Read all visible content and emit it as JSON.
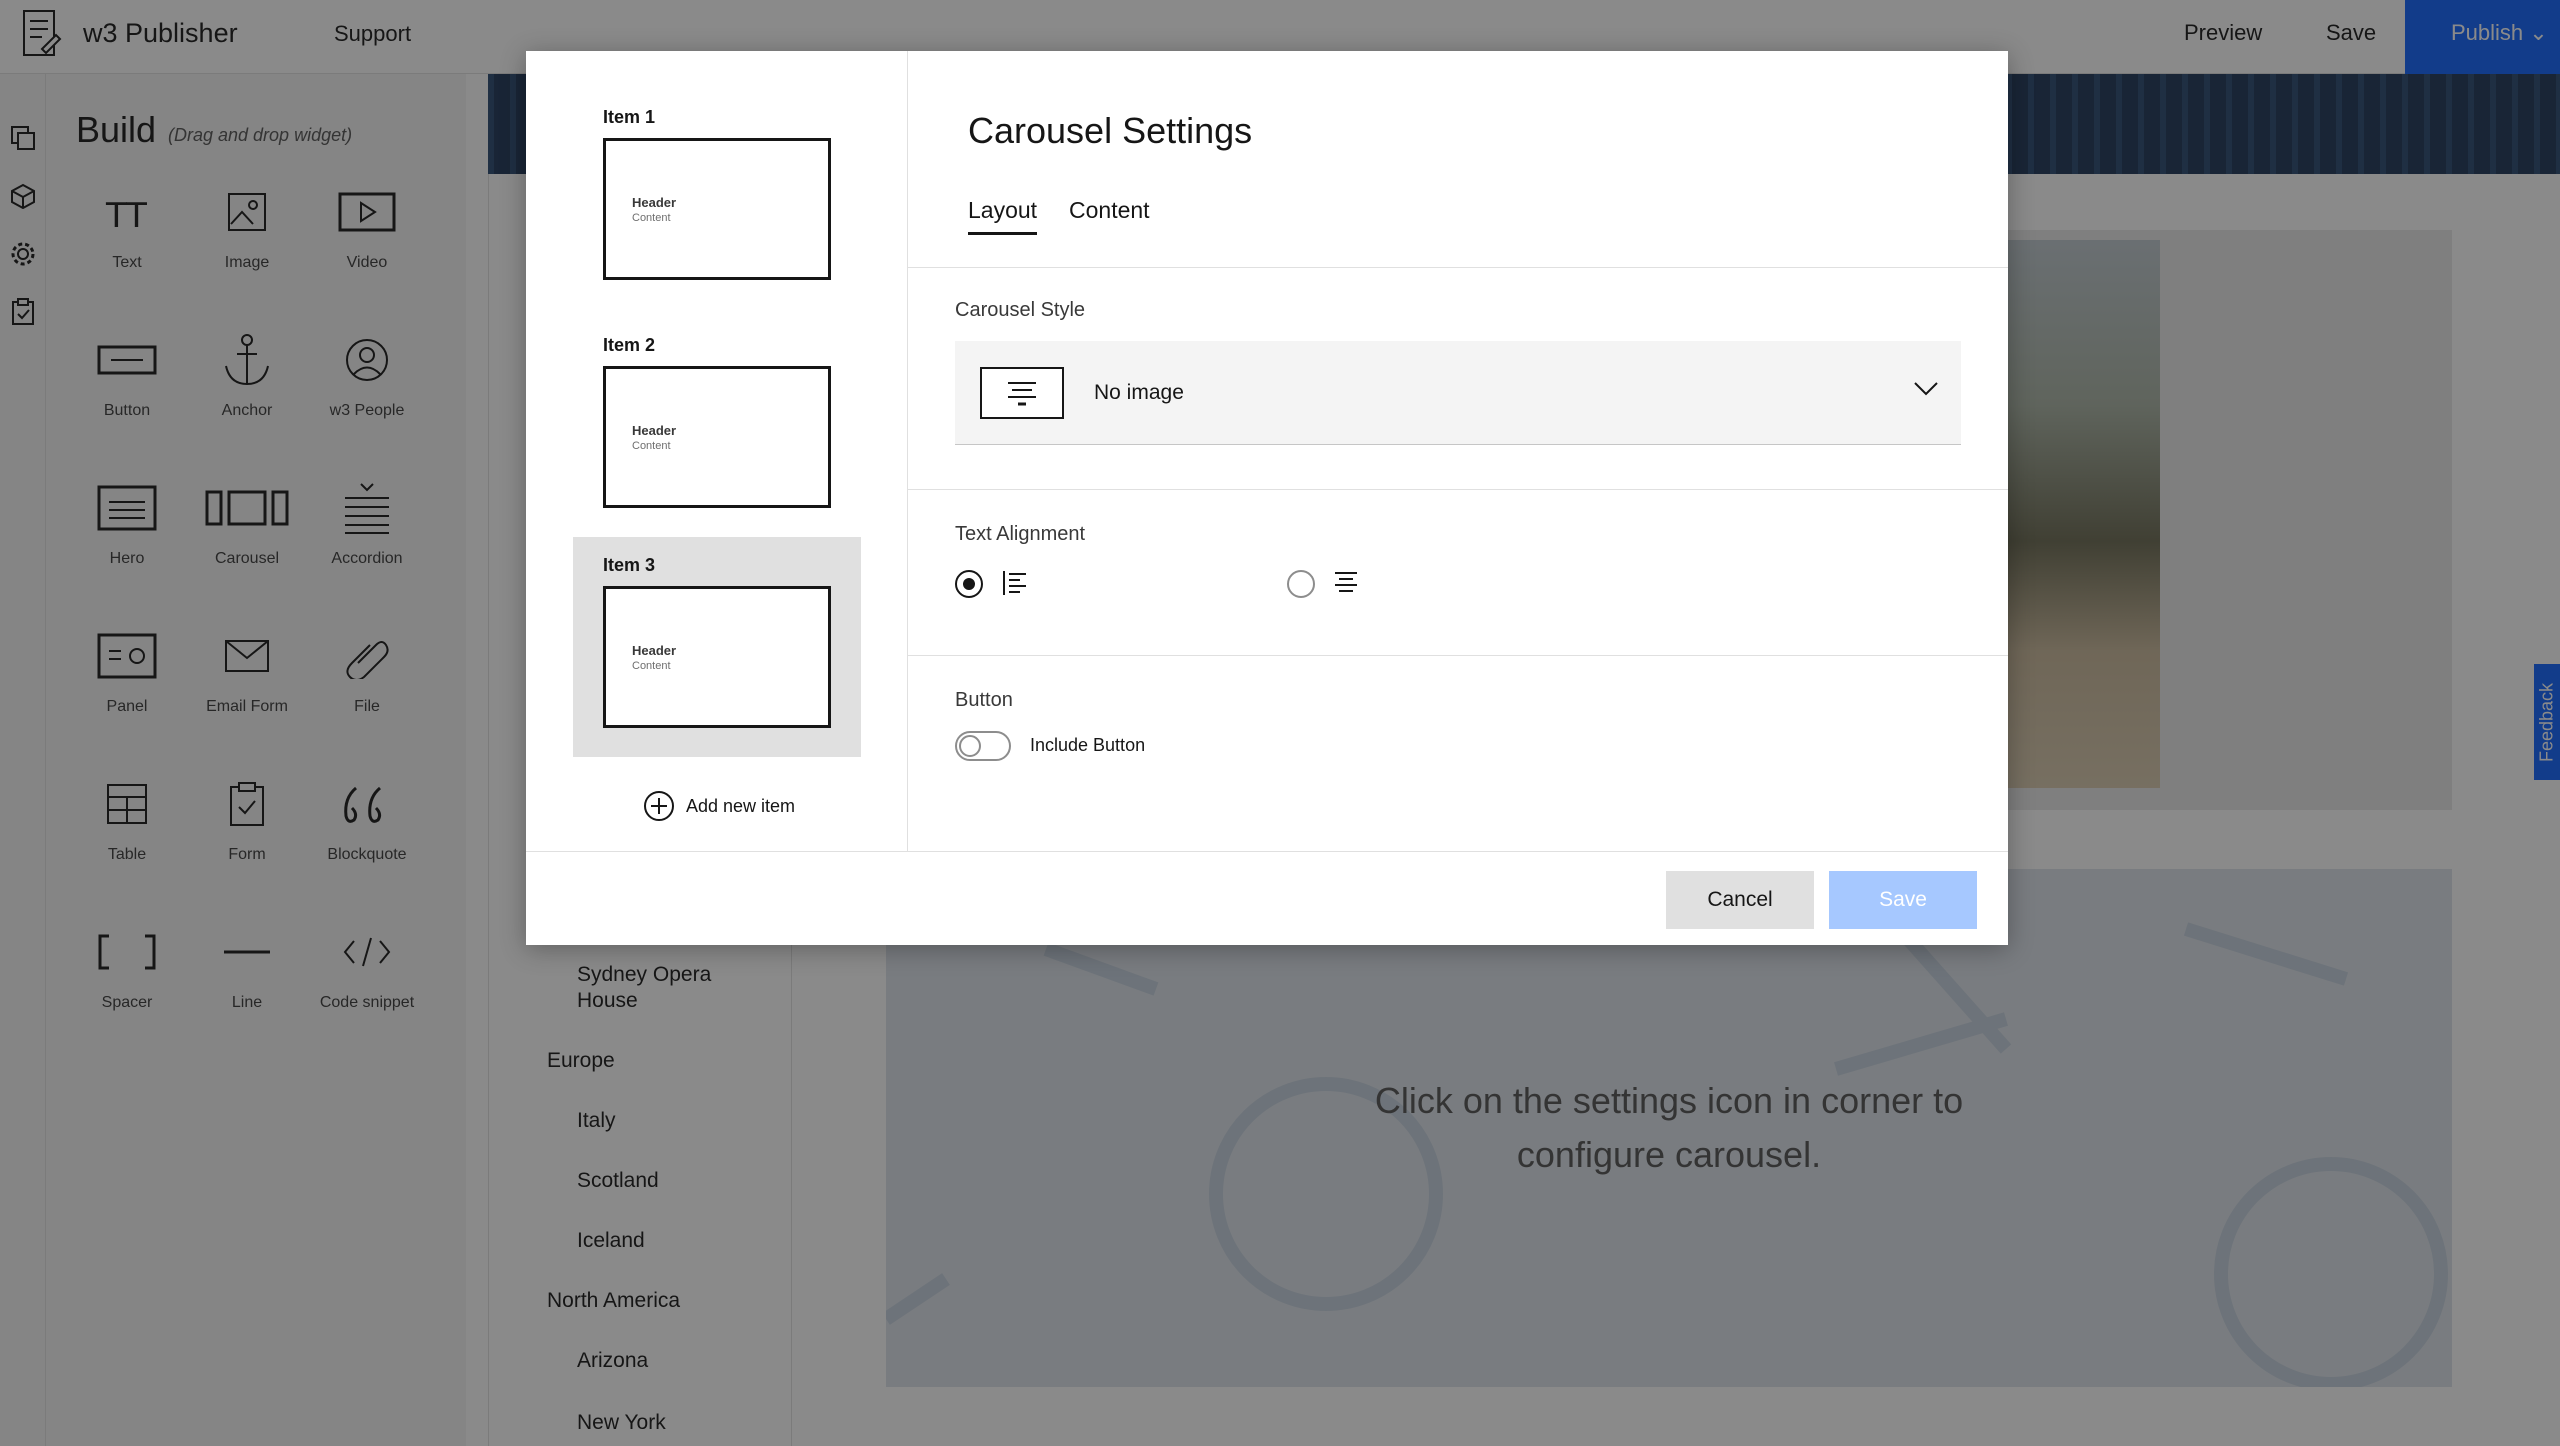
{
  "topbar": {
    "app_title": "w3 Publisher",
    "support": "Support",
    "preview": "Preview",
    "save": "Save",
    "publish": "Publish"
  },
  "build": {
    "title": "Build",
    "subtitle": "(Drag and drop widget)",
    "widgets": [
      {
        "label": "Text",
        "icon": "text-icon"
      },
      {
        "label": "Image",
        "icon": "image-icon"
      },
      {
        "label": "Video",
        "icon": "video-icon"
      },
      {
        "label": "Button",
        "icon": "button-icon"
      },
      {
        "label": "Anchor",
        "icon": "anchor-icon"
      },
      {
        "label": "w3 People",
        "icon": "people-icon"
      },
      {
        "label": "Hero",
        "icon": "hero-icon"
      },
      {
        "label": "Carousel",
        "icon": "carousel-icon"
      },
      {
        "label": "Accordion",
        "icon": "accordion-icon"
      },
      {
        "label": "Panel",
        "icon": "panel-icon"
      },
      {
        "label": "Email Form",
        "icon": "email-icon"
      },
      {
        "label": "File",
        "icon": "paperclip-icon"
      },
      {
        "label": "Table",
        "icon": "table-icon"
      },
      {
        "label": "Form",
        "icon": "clipboard-icon"
      },
      {
        "label": "Blockquote",
        "icon": "quote-icon"
      },
      {
        "label": "Spacer",
        "icon": "spacer-icon"
      },
      {
        "label": "Line",
        "icon": "line-icon"
      },
      {
        "label": "Code snippet",
        "icon": "code-icon"
      }
    ]
  },
  "tree": {
    "items": [
      "Sydney Opera House",
      "Europe",
      "Italy",
      "Scotland",
      "Iceland",
      "North America",
      "Arizona",
      "New York"
    ]
  },
  "canvas": {
    "placeholder_text": "Click on the settings icon in corner to configure carousel."
  },
  "feedback": "Feedback",
  "modal": {
    "title": "Carousel Settings",
    "tabs": [
      "Layout",
      "Content"
    ],
    "items": [
      {
        "label": "Item 1",
        "header": "Header",
        "content": "Content"
      },
      {
        "label": "Item 2",
        "header": "Header",
        "content": "Content"
      },
      {
        "label": "Item 3",
        "header": "Header",
        "content": "Content"
      }
    ],
    "add_item": "Add new item",
    "carousel_style_label": "Carousel Style",
    "carousel_style_value": "No image",
    "text_alignment_label": "Text Alignment",
    "text_alignment_options": [
      "left-align-icon",
      "center-align-icon"
    ],
    "text_alignment_selected": "left-align-icon",
    "button_label": "Button",
    "include_button": "Include Button",
    "include_button_on": false,
    "cancel": "Cancel",
    "save": "Save"
  }
}
